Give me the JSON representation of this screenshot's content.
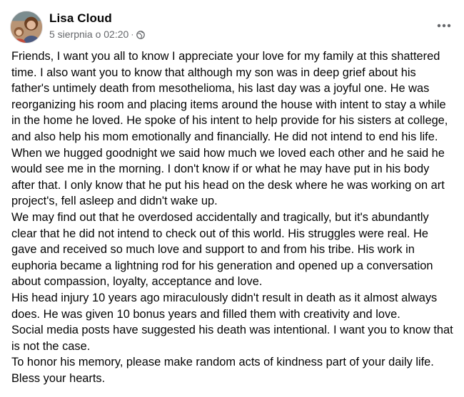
{
  "post": {
    "author": "Lisa Cloud",
    "timestamp": "5 sierpnia o 02:20",
    "separator": "·",
    "privacy_icon": "globe-icon",
    "more_icon": "more-options-icon",
    "paragraphs": [
      "Friends, I want you all to know I appreciate your love for my family at this shattered time. I also want you to know that although my son was in deep grief about his father's untimely death from mesothelioma, his last day was a joyful one. He was reorganizing his room and placing items around the house with intent to stay a while in the home he loved. He spoke of his intent to help provide for his sisters at college, and also help his mom emotionally and financially. He did not intend to end his life. When we hugged goodnight we said how much we loved each other and he said he would see me in the morning. I don't know if or what he may have put in his body after that. I only know that he put his head on the desk where he was working on art project's, fell asleep and didn't wake up.",
      "We may find out that he overdosed accidentally and tragically, but it's abundantly clear that he did not intend to check out of this world. His struggles were real. He gave and received so much love and support to and from his tribe. His work in euphoria became a lightning rod for his generation and opened up a conversation about compassion, loyalty, acceptance and love.",
      "His head injury 10 years ago miraculously didn't result in death as it almost always does. He was given 10 bonus years and filled them with creativity and love.",
      "Social media posts have suggested his death was intentional. I want you to know that is not the case.",
      "To honor his memory, please make random acts of kindness part of your daily life. Bless your hearts."
    ]
  },
  "colors": {
    "text": "#050505",
    "secondary_text": "#65676b",
    "background": "#ffffff"
  }
}
